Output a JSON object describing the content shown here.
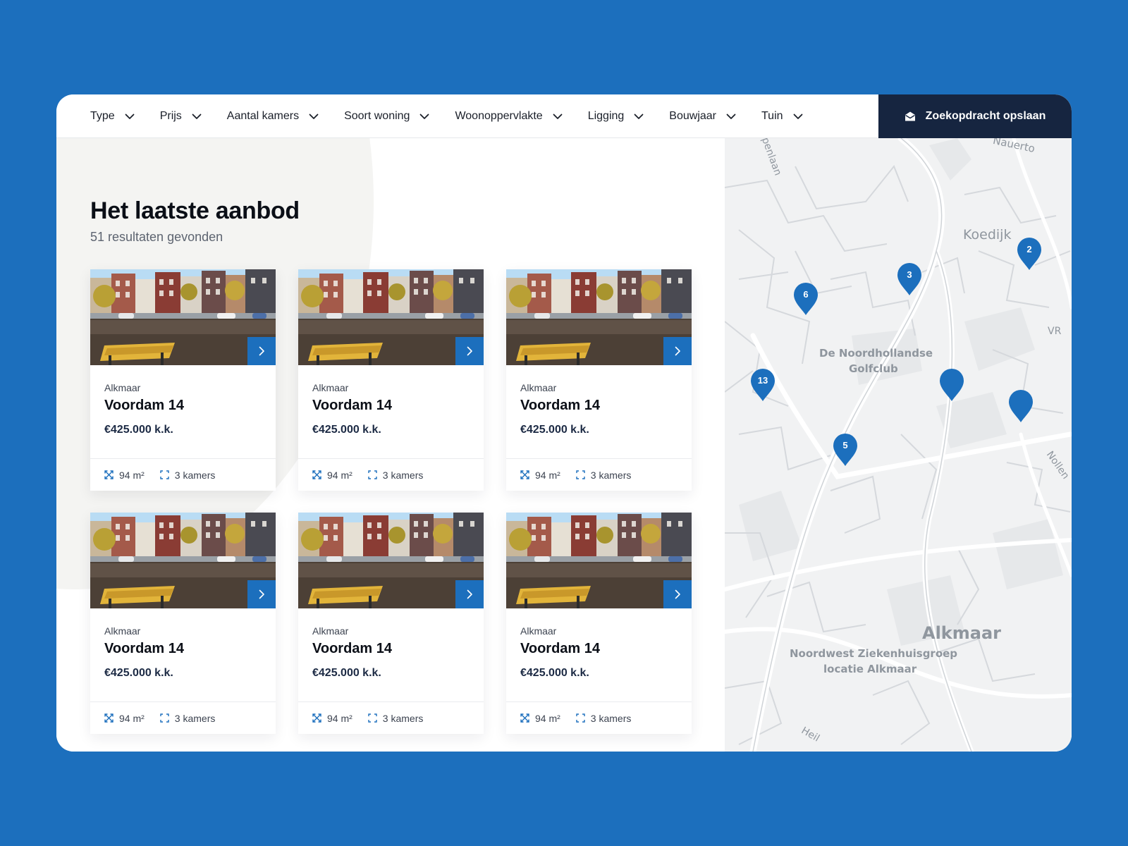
{
  "filters": [
    {
      "label": "Type"
    },
    {
      "label": "Prijs"
    },
    {
      "label": "Aantal kamers"
    },
    {
      "label": "Soort woning"
    },
    {
      "label": "Woonoppervlakte"
    },
    {
      "label": "Ligging"
    },
    {
      "label": "Bouwjaar"
    },
    {
      "label": "Tuin"
    }
  ],
  "save_search": {
    "label": "Zoekopdracht opslaan",
    "icon": "envelope-icon"
  },
  "main": {
    "title": "Het laatste aanbod",
    "results": "51 resultaten gevonden"
  },
  "listings": [
    {
      "city": "Alkmaar",
      "street": "Voordam 14",
      "price": "€425.000 k.k.",
      "area": "94 m²",
      "rooms": "3 kamers"
    },
    {
      "city": "Alkmaar",
      "street": "Voordam 14",
      "price": "€425.000 k.k.",
      "area": "94 m²",
      "rooms": "3 kamers"
    },
    {
      "city": "Alkmaar",
      "street": "Voordam 14",
      "price": "€425.000 k.k.",
      "area": "94 m²",
      "rooms": "3 kamers"
    },
    {
      "city": "Alkmaar",
      "street": "Voordam 14",
      "price": "€425.000 k.k.",
      "area": "94 m²",
      "rooms": "3 kamers"
    },
    {
      "city": "Alkmaar",
      "street": "Voordam 14",
      "price": "€425.000 k.k.",
      "area": "94 m²",
      "rooms": "3 kamers"
    },
    {
      "city": "Alkmaar",
      "street": "Voordam 14",
      "price": "€425.000 k.k.",
      "area": "94 m²",
      "rooms": "3 kamers"
    }
  ],
  "map": {
    "labels": {
      "koedijk": "Koedijk",
      "golf": "De Noordhollandse",
      "golf2": "Golfclub",
      "alkmaar": "Alkmaar",
      "hospital": "Noordwest Ziekenhuisgroep",
      "hospital2": "locatie Alkmaar",
      "road1": "Nauerto",
      "road2": "penlaan",
      "road3": "Nollen",
      "road4": "Heil",
      "road5": "VR"
    },
    "pins": [
      {
        "count": "6"
      },
      {
        "count": "3"
      },
      {
        "count": "2"
      },
      {
        "count": "13"
      },
      {
        "count": ""
      },
      {
        "count": ""
      },
      {
        "count": "5"
      }
    ]
  },
  "colors": {
    "brand": "#1c6fbd",
    "navy": "#162540",
    "background": "#1c6fbd"
  }
}
